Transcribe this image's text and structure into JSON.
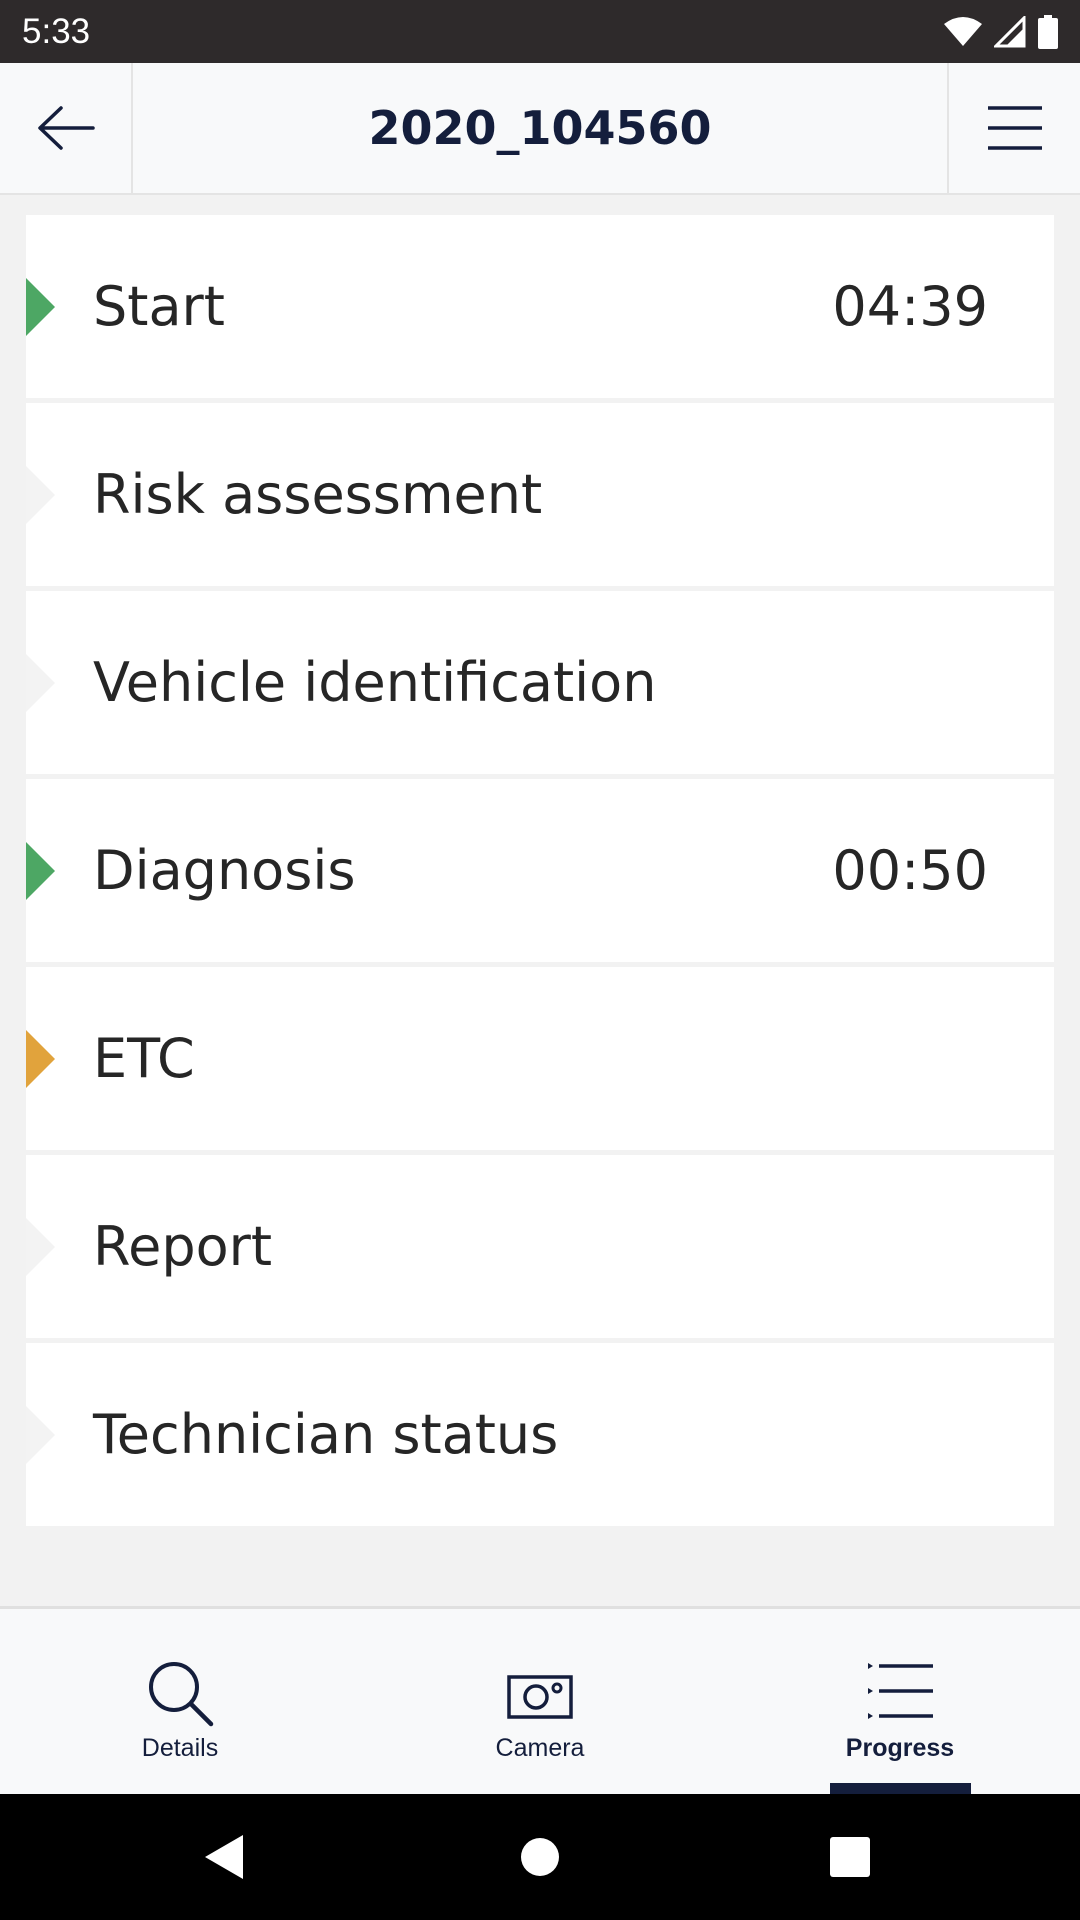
{
  "status_bar": {
    "time": "5:33",
    "icons": [
      "wifi-icon",
      "signal-icon",
      "battery-icon"
    ]
  },
  "header": {
    "title": "2020_104560",
    "back_icon": "arrow-left-icon",
    "menu_icon": "hamburger-menu-icon"
  },
  "steps": [
    {
      "label": "Start",
      "time": "04:39",
      "status": "done"
    },
    {
      "label": "Risk assessment",
      "time": "",
      "status": "pending"
    },
    {
      "label": "Vehicle identification",
      "time": "",
      "status": "pending"
    },
    {
      "label": "Diagnosis",
      "time": "00:50",
      "status": "done"
    },
    {
      "label": "ETC",
      "time": "",
      "status": "active"
    },
    {
      "label": "Report",
      "time": "",
      "status": "pending"
    },
    {
      "label": "Technician status",
      "time": "",
      "status": "pending"
    }
  ],
  "status_colors": {
    "done": "#4da764",
    "active": "#e1a33c",
    "pending": "#f3f3f3"
  },
  "tabs": [
    {
      "label": "Details",
      "icon": "search-icon",
      "selected": false
    },
    {
      "label": "Camera",
      "icon": "camera-icon",
      "selected": false
    },
    {
      "label": "Progress",
      "icon": "progress-list-icon",
      "selected": true
    }
  ],
  "nav_bar": {
    "buttons": [
      "back-triangle-icon",
      "home-circle-icon",
      "recents-square-icon"
    ]
  },
  "colors": {
    "brand_navy": "#141e3c",
    "status_bar": "#2e2a2b",
    "background": "#f2f2f2"
  }
}
